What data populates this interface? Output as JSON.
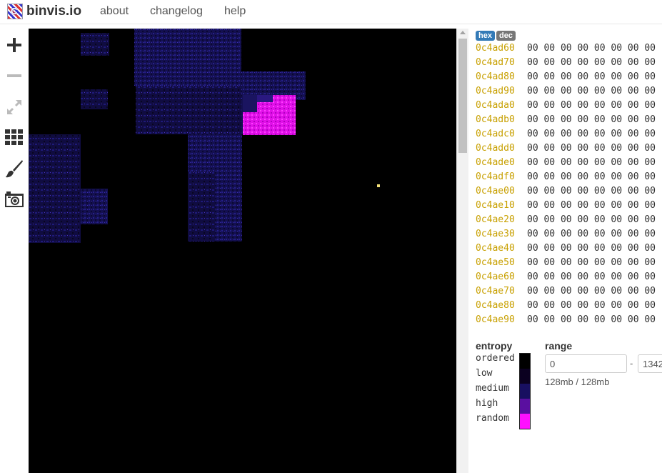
{
  "app": {
    "brand": "binvis.io"
  },
  "nav": {
    "items": [
      {
        "label": "about"
      },
      {
        "label": "changelog"
      },
      {
        "label": "help"
      }
    ]
  },
  "toolbar": {
    "tools": [
      {
        "icon": "zoom-in-icon"
      },
      {
        "icon": "zoom-out-icon",
        "disabled": true
      },
      {
        "icon": "expand-icon",
        "disabled": true
      },
      {
        "icon": "grid-icon"
      },
      {
        "icon": "brush-icon"
      },
      {
        "icon": "camera-icon"
      }
    ]
  },
  "hexview": {
    "modes": {
      "hex": "hex",
      "dec": "dec"
    },
    "rows": [
      {
        "address": "0c4ad60",
        "bytes": "00 00 00 00 00 00 00 00"
      },
      {
        "address": "0c4ad70",
        "bytes": "00 00 00 00 00 00 00 00"
      },
      {
        "address": "0c4ad80",
        "bytes": "00 00 00 00 00 00 00 00"
      },
      {
        "address": "0c4ad90",
        "bytes": "00 00 00 00 00 00 00 00"
      },
      {
        "address": "0c4ada0",
        "bytes": "00 00 00 00 00 00 00 00"
      },
      {
        "address": "0c4adb0",
        "bytes": "00 00 00 00 00 00 00 00"
      },
      {
        "address": "0c4adc0",
        "bytes": "00 00 00 00 00 00 00 00"
      },
      {
        "address": "0c4add0",
        "bytes": "00 00 00 00 00 00 00 00"
      },
      {
        "address": "0c4ade0",
        "bytes": "00 00 00 00 00 00 00 00"
      },
      {
        "address": "0c4adf0",
        "bytes": "00 00 00 00 00 00 00 00"
      },
      {
        "address": "0c4ae00",
        "bytes": "00 00 00 00 00 00 00 00"
      },
      {
        "address": "0c4ae10",
        "bytes": "00 00 00 00 00 00 00 00"
      },
      {
        "address": "0c4ae20",
        "bytes": "00 00 00 00 00 00 00 00"
      },
      {
        "address": "0c4ae30",
        "bytes": "00 00 00 00 00 00 00 00"
      },
      {
        "address": "0c4ae40",
        "bytes": "00 00 00 00 00 00 00 00"
      },
      {
        "address": "0c4ae50",
        "bytes": "00 00 00 00 00 00 00 00"
      },
      {
        "address": "0c4ae60",
        "bytes": "00 00 00 00 00 00 00 00"
      },
      {
        "address": "0c4ae70",
        "bytes": "00 00 00 00 00 00 00 00"
      },
      {
        "address": "0c4ae80",
        "bytes": "00 00 00 00 00 00 00 00"
      },
      {
        "address": "0c4ae90",
        "bytes": "00 00 00 00 00 00 00 00"
      }
    ]
  },
  "legend": {
    "title": "entropy",
    "levels": [
      {
        "label": "ordered",
        "color": "#000000"
      },
      {
        "label": "low",
        "color": "#0b0020"
      },
      {
        "label": "medium",
        "color": "#180f60"
      },
      {
        "label": "high",
        "color": "#5a0fa0"
      },
      {
        "label": "random",
        "color": "#ff10ff"
      }
    ]
  },
  "range": {
    "title": "range",
    "start": "0",
    "end": "1342",
    "separator": "-",
    "size_text": "128mb / 128mb"
  },
  "colors": {
    "address": "#c8a000",
    "badge_hex": "#337ab7",
    "badge_dec": "#777777"
  }
}
